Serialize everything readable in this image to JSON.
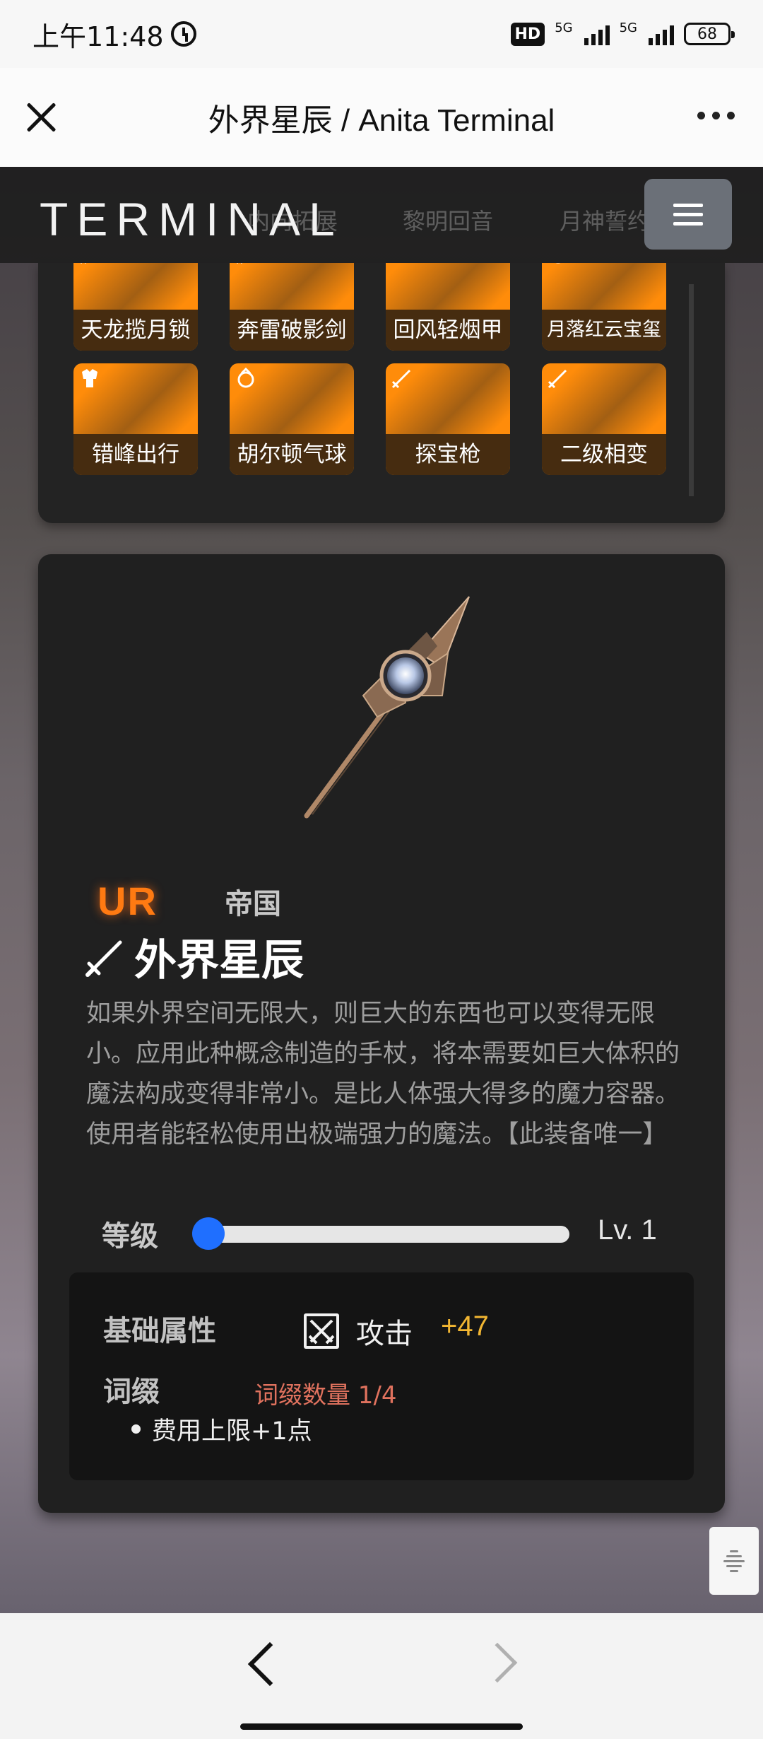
{
  "status_bar": {
    "time": "上午11:48",
    "hd": "HD",
    "network_1": "5G",
    "network_2": "5G",
    "battery": "68"
  },
  "browser": {
    "title": "外界星辰 / Anita Terminal"
  },
  "site": {
    "brand": "TERMINAL",
    "ghost_tabs": [
      "内向拓展",
      "黎明回音",
      "月神誓约"
    ]
  },
  "grid_items": [
    {
      "label": "天龙揽月锁",
      "type": "sword-icon"
    },
    {
      "label": "奔雷破影剑",
      "type": "sword-icon"
    },
    {
      "label": "回风轻烟甲",
      "type": "crown-icon"
    },
    {
      "label": "月落红云宝玺",
      "type": "ring-icon"
    },
    {
      "label": "错峰出行",
      "type": "armor-icon"
    },
    {
      "label": "胡尔顿气球",
      "type": "ring-icon"
    },
    {
      "label": "探宝枪",
      "type": "sword-icon"
    },
    {
      "label": "二级相变",
      "type": "sword-icon"
    }
  ],
  "detail": {
    "rarity": "UR",
    "faction": "帝国",
    "name": "外界星辰",
    "description": "如果外界空间无限大，则巨大的东西也可以变得无限小。应用此种概念制造的手杖，将本需要如巨大体积的魔法构成变得非常小。是比人体强大得多的魔力容器。使用者能轻松使用出极端强力的魔法。【此装备唯一】",
    "level_label": "等级",
    "level_value": "Lv. 1",
    "level_fraction": 0.0,
    "base_stats_label": "基础属性",
    "attack_label": "攻击",
    "attack_value": "+47",
    "affix_label": "词缀",
    "affix_count": "词缀数量 1/4",
    "affixes": [
      "费用上限+1点"
    ]
  },
  "colors": {
    "rarity": "#ff7a12",
    "tile": "#ff8c0a",
    "attack_value": "#f2b632",
    "affix_count": "#e0725e",
    "slider": "#1f6fff"
  }
}
